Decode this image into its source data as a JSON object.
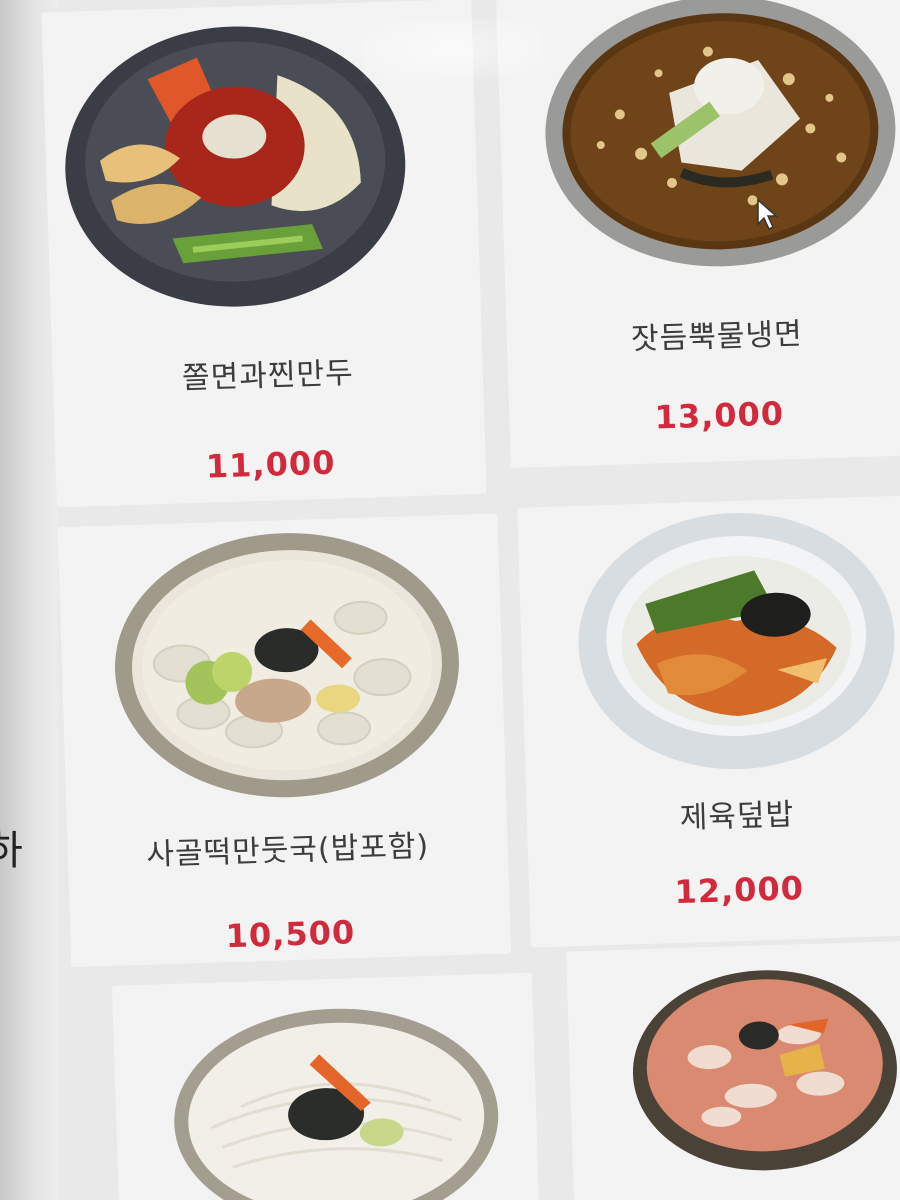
{
  "side": {
    "partial_char": "하"
  },
  "menu": {
    "items": [
      {
        "name": "쫄면과찐만두",
        "price": "11,000",
        "icon": "jjolmyeon-dumpling-dish"
      },
      {
        "name": "잣듬뿍물냉면",
        "price": "13,000",
        "icon": "naengmyeon-dish"
      },
      {
        "name": "사골떡만둣국(밥포함)",
        "price": "10,500",
        "icon": "tteok-mandu-soup-dish"
      },
      {
        "name": "제육덮밥",
        "price": "12,000",
        "icon": "jeyuk-rice-bowl-dish"
      },
      {
        "name": "",
        "price": "",
        "icon": "kalguksu-dish"
      },
      {
        "name": "",
        "price": "",
        "icon": "spicy-noodle-soup-dish"
      }
    ]
  },
  "colors": {
    "price": "#d02a3c",
    "name": "#3c3c3c",
    "card": "#f3f3f3"
  }
}
